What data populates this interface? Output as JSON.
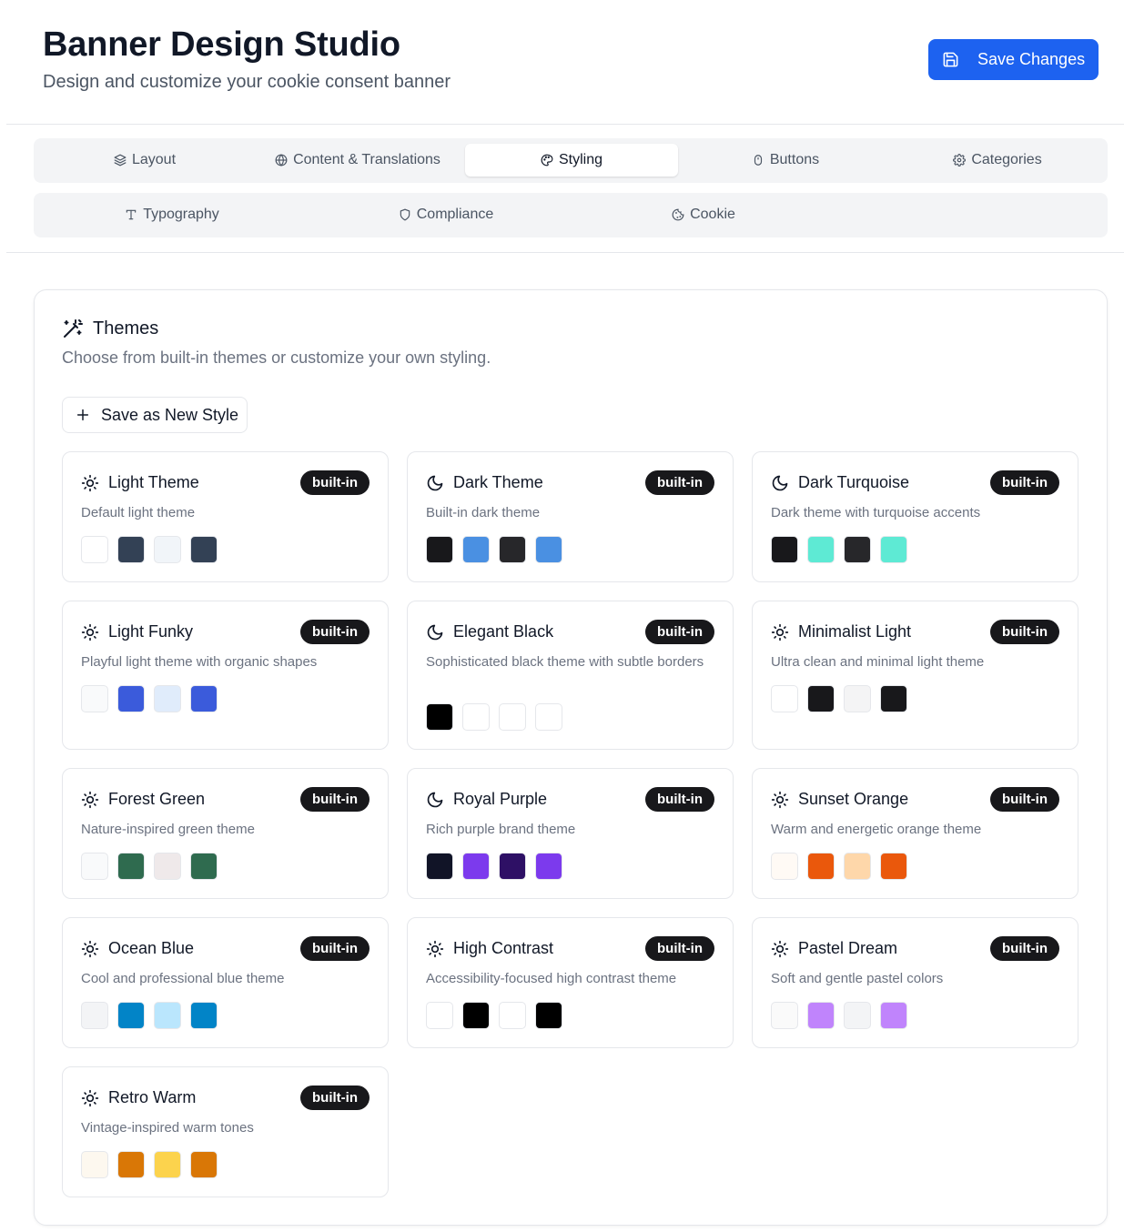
{
  "header": {
    "title": "Banner Design Studio",
    "subtitle": "Design and customize your cookie consent banner",
    "save_label": "Save Changes",
    "save_icon": "save-icon"
  },
  "tabs": [
    {
      "label": "Layout",
      "icon": "layers-icon",
      "active": false
    },
    {
      "label": "Content & Translations",
      "icon": "globe-icon",
      "active": false
    },
    {
      "label": "Styling",
      "icon": "palette-icon",
      "active": true
    },
    {
      "label": "Buttons",
      "icon": "mouse-icon",
      "active": false
    },
    {
      "label": "Categories",
      "icon": "gear-icon",
      "active": false
    },
    {
      "label": "Typography",
      "icon": "type-icon",
      "active": false
    },
    {
      "label": "Compliance",
      "icon": "shield-icon",
      "active": false
    },
    {
      "label": "Cookie",
      "icon": "cookie-icon",
      "active": false
    }
  ],
  "themes_panel": {
    "title": "Themes",
    "title_icon": "wand-icon",
    "description": "Choose from built-in themes or customize your own styling.",
    "new_style_label": "Save as New Style"
  },
  "badge_label": "built-in",
  "themes": [
    {
      "name": "Light Theme",
      "mode": "light",
      "description": "Default light theme",
      "colors": [
        "#ffffff",
        "#334155",
        "#f1f5f9",
        "#334155"
      ]
    },
    {
      "name": "Dark Theme",
      "mode": "dark",
      "description": "Built-in dark theme",
      "colors": [
        "#18181b",
        "#4a90e2",
        "#27272a",
        "#4a90e2"
      ]
    },
    {
      "name": "Dark Turquoise",
      "mode": "dark",
      "description": "Dark theme with turquoise accents",
      "colors": [
        "#18181b",
        "#5eead4",
        "#27272a",
        "#5eead4"
      ]
    },
    {
      "name": "Light Funky",
      "mode": "light",
      "description": "Playful light theme with organic shapes",
      "colors": [
        "#f9fafb",
        "#3b5bdb",
        "#e0ecfb",
        "#3b5bdb"
      ]
    },
    {
      "name": "Elegant Black",
      "mode": "dark",
      "description": "Sophisticated black theme with subtle borders",
      "colors": [
        "#000000",
        "#ffffff",
        "#ffffff",
        "#ffffff"
      ]
    },
    {
      "name": "Minimalist Light",
      "mode": "light",
      "description": "Ultra clean and minimal light theme",
      "colors": [
        "#ffffff",
        "#18181b",
        "#f4f4f5",
        "#18181b"
      ]
    },
    {
      "name": "Forest Green",
      "mode": "light",
      "description": "Nature-inspired green theme",
      "colors": [
        "#f9fafb",
        "#2f6b4f",
        "#efe9ea",
        "#2f6b4f"
      ]
    },
    {
      "name": "Royal Purple",
      "mode": "dark",
      "description": "Rich purple brand theme",
      "colors": [
        "#111427",
        "#7c3aed",
        "#2e1065",
        "#7c3aed"
      ]
    },
    {
      "name": "Sunset Orange",
      "mode": "light",
      "description": "Warm and energetic orange theme",
      "colors": [
        "#fffaf5",
        "#ea580c",
        "#fed7aa",
        "#ea580c"
      ]
    },
    {
      "name": "Ocean Blue",
      "mode": "light",
      "description": "Cool and professional blue theme",
      "colors": [
        "#f3f4f6",
        "#0284c7",
        "#bae6fd",
        "#0284c7"
      ]
    },
    {
      "name": "High Contrast",
      "mode": "light",
      "description": "Accessibility-focused high contrast theme",
      "colors": [
        "#ffffff",
        "#000000",
        "#ffffff",
        "#000000"
      ]
    },
    {
      "name": "Pastel Dream",
      "mode": "light",
      "description": "Soft and gentle pastel colors",
      "colors": [
        "#fafafa",
        "#c084fc",
        "#f3f4f6",
        "#c084fc"
      ]
    },
    {
      "name": "Retro Warm",
      "mode": "light",
      "description": "Vintage-inspired warm tones",
      "colors": [
        "#fdf8ef",
        "#d97706",
        "#fcd34d",
        "#d97706"
      ]
    }
  ]
}
